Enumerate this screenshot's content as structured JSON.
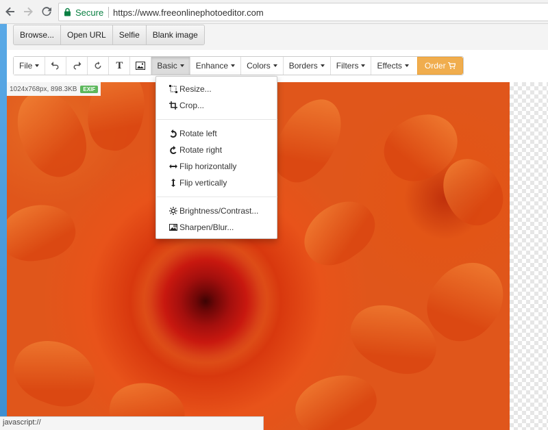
{
  "browser": {
    "secure_label": "Secure",
    "url": "https://www.freeonlinephotoeditor.com",
    "status_text": "javascript://"
  },
  "top_buttons": [
    "Browse...",
    "Open URL",
    "Selfie",
    "Blank image"
  ],
  "toolbar": {
    "file": "File",
    "text_icon_glyph": "T",
    "basic": "Basic",
    "enhance": "Enhance",
    "colors": "Colors",
    "borders": "Borders",
    "filters": "Filters",
    "effects": "Effects",
    "order": "Order"
  },
  "image_info": {
    "dimensions": "1024x768px, 898.3KB",
    "exif_badge": "EXIF"
  },
  "basic_menu": {
    "resize": "Resize...",
    "crop": "Crop...",
    "rotate_left": "Rotate left",
    "rotate_right": "Rotate right",
    "flip_h": "Flip horizontally",
    "flip_v": "Flip vertically",
    "brightness": "Brightness/Contrast...",
    "sharpen": "Sharpen/Blur..."
  },
  "colors": {
    "secure_green": "#0b8043",
    "order_orange": "#f0ad4e",
    "exif_green": "#5cb85c"
  }
}
